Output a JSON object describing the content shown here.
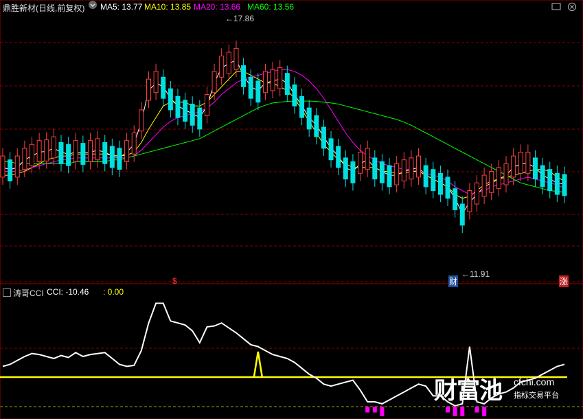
{
  "header": {
    "title": "鼎胜新材(日线,前复权)",
    "ma5_label": "MA5: 13.77",
    "ma10_label": "MA10: 13.85",
    "ma20_label": "MA20: 13.66",
    "ma60_label": "MA60: 13.56",
    "dropdown_icon": "chevron-down-icon",
    "window_buttons": [
      "restore-icon",
      "close-icon"
    ]
  },
  "colors": {
    "up": "#ff4040",
    "down": "#00e0e0",
    "ma5": "#ffffff",
    "ma10": "#ffff00",
    "ma20": "#ff00ff",
    "ma60": "#00ff00",
    "cci_line": "#ffffff",
    "baseline": "#ffff00",
    "grid": "#8a0000",
    "neg_fill": "#ff00ff"
  },
  "price_panel": {
    "high_label": "17.86",
    "low_label": "11.91",
    "markers": [
      "$",
      "财",
      "涨"
    ]
  },
  "indicator_panel": {
    "name": "涛哥CCI",
    "value_label": "CCI: -10.46",
    "zero_label": ": 0.00"
  },
  "watermark": {
    "logo_text": "财富池",
    "site": "cfchi.com",
    "slogan": "指标交易平台"
  },
  "chart_data": [
    {
      "type": "candlestick",
      "title": "鼎胜新材(日线,前复权)",
      "ylim": [
        11.5,
        18.2
      ],
      "annotations": [
        {
          "text": "17.86",
          "type": "high"
        },
        {
          "text": "11.91",
          "type": "low"
        }
      ],
      "series": [
        {
          "name": "MA5",
          "values": [
            14.2,
            14.15,
            14.2,
            14.4,
            14.5,
            14.6,
            14.62,
            14.7,
            14.6,
            14.55,
            14.6,
            14.58,
            14.6,
            14.65,
            14.6,
            14.5,
            14.45,
            14.6,
            14.8,
            15.4,
            16.2,
            16.4,
            16.3,
            16.0,
            15.8,
            15.7,
            15.6,
            15.5,
            15.8,
            16.4,
            16.8,
            16.9,
            17.0,
            16.6,
            16.3,
            16.2,
            16.4,
            16.45,
            16.5,
            16.4,
            16.1,
            15.8,
            15.5,
            15.3,
            15.0,
            14.7,
            14.5,
            14.2,
            14.1,
            14.3,
            14.4,
            14.2,
            14.1,
            14.0,
            14.0,
            14.1,
            14.15,
            14.2,
            14.0,
            13.9,
            13.8,
            13.7,
            13.4,
            13.0,
            13.3,
            13.5,
            13.7,
            13.8,
            13.9,
            14.0,
            14.2,
            14.3,
            14.3,
            14.2,
            14.0,
            13.9,
            13.8,
            13.77
          ]
        },
        {
          "name": "MA10",
          "values": [
            14.0,
            14.0,
            14.05,
            14.1,
            14.2,
            14.3,
            14.4,
            14.45,
            14.5,
            14.5,
            14.55,
            14.55,
            14.55,
            14.55,
            14.55,
            14.52,
            14.5,
            14.52,
            14.6,
            14.85,
            15.2,
            15.5,
            15.8,
            15.9,
            15.9,
            15.9,
            15.8,
            15.8,
            15.9,
            16.1,
            16.3,
            16.5,
            16.7,
            16.7,
            16.6,
            16.5,
            16.4,
            16.4,
            16.3,
            16.2,
            16.0,
            15.7,
            15.4,
            15.1,
            14.8,
            14.6,
            14.4,
            14.3,
            14.2,
            14.2,
            14.2,
            14.2,
            14.1,
            14.1,
            14.05,
            14.05,
            14.1,
            14.1,
            14.0,
            13.9,
            13.8,
            13.7,
            13.5,
            13.4,
            13.45,
            13.6,
            13.75,
            13.85,
            13.9,
            13.95,
            14.0,
            14.05,
            14.1,
            14.15,
            14.15,
            14.1,
            13.95,
            13.85
          ]
        },
        {
          "name": "MA20",
          "values": [
            14.1,
            14.1,
            14.1,
            14.15,
            14.2,
            14.25,
            14.3,
            14.35,
            14.4,
            14.42,
            14.45,
            14.45,
            14.45,
            14.45,
            14.45,
            14.45,
            14.45,
            14.45,
            14.5,
            14.65,
            14.85,
            15.05,
            15.25,
            15.4,
            15.5,
            15.55,
            15.6,
            15.65,
            15.75,
            15.9,
            16.1,
            16.25,
            16.4,
            16.5,
            16.55,
            16.6,
            16.65,
            16.7,
            16.75,
            16.75,
            16.7,
            16.6,
            16.45,
            16.25,
            16.0,
            15.7,
            15.4,
            15.1,
            14.85,
            14.65,
            14.5,
            14.4,
            14.3,
            14.25,
            14.2,
            14.15,
            14.15,
            14.1,
            14.05,
            14.0,
            13.95,
            13.85,
            13.7,
            13.6,
            13.5,
            13.55,
            13.6,
            13.7,
            13.75,
            13.8,
            13.85,
            13.9,
            13.95,
            13.9,
            13.85,
            13.8,
            13.75,
            13.66
          ]
        },
        {
          "name": "MA60",
          "values": [
            14.35,
            14.35,
            14.3,
            14.3,
            14.3,
            14.3,
            14.3,
            14.3,
            14.3,
            14.3,
            14.35,
            14.35,
            14.35,
            14.35,
            14.35,
            14.4,
            14.4,
            14.45,
            14.5,
            14.55,
            14.6,
            14.65,
            14.7,
            14.75,
            14.8,
            14.85,
            14.9,
            14.95,
            15.05,
            15.15,
            15.25,
            15.35,
            15.45,
            15.55,
            15.65,
            15.75,
            15.82,
            15.88,
            15.9,
            15.92,
            15.93,
            15.93,
            15.93,
            15.92,
            15.9,
            15.88,
            15.85,
            15.8,
            15.75,
            15.7,
            15.65,
            15.6,
            15.55,
            15.5,
            15.45,
            15.38,
            15.3,
            15.2,
            15.1,
            15.0,
            14.9,
            14.8,
            14.7,
            14.6,
            14.5,
            14.4,
            14.3,
            14.2,
            14.1,
            14.0,
            13.9,
            13.8,
            13.75,
            13.7,
            13.65,
            13.6,
            13.58,
            13.56
          ]
        }
      ]
    },
    {
      "type": "line",
      "title": "涛哥CCI",
      "ylim": [
        -280,
        340
      ],
      "series": [
        {
          "name": "CCI",
          "values": [
            -20,
            -10,
            10,
            30,
            45,
            40,
            30,
            20,
            35,
            25,
            50,
            30,
            40,
            45,
            50,
            20,
            -10,
            -20,
            -15,
            60,
            200,
            300,
            300,
            210,
            200,
            190,
            160,
            100,
            180,
            185,
            200,
            175,
            150,
            120,
            90,
            80,
            60,
            40,
            30,
            20,
            0,
            -30,
            -60,
            -80,
            -110,
            -120,
            -110,
            -100,
            -90,
            -140,
            -200,
            -200,
            -210,
            -190,
            -170,
            -150,
            -130,
            -110,
            -120,
            -170,
            -170,
            -200,
            -220,
            -210,
            80,
            -200,
            -210,
            -180,
            -160,
            -150,
            -130,
            -100,
            -90,
            -80,
            -60,
            -40,
            -20,
            -10
          ]
        },
        {
          "name": "0.00",
          "values": [
            0,
            0,
            0,
            0,
            0,
            0,
            0,
            0,
            0,
            0,
            0,
            0,
            0,
            0,
            0,
            0,
            0,
            0,
            0,
            0,
            0,
            0,
            0,
            0,
            0,
            0,
            0,
            0,
            0,
            0,
            0,
            0,
            0,
            0,
            0,
            0,
            0,
            0,
            0,
            0,
            0,
            0,
            0,
            0,
            0,
            0,
            0,
            0,
            0,
            0,
            0,
            0,
            0,
            0,
            0,
            0,
            0,
            0,
            0,
            0,
            0,
            0,
            0,
            0,
            0,
            0,
            0,
            0,
            0,
            0,
            0,
            0,
            0,
            0,
            0,
            0,
            0,
            0
          ]
        }
      ]
    }
  ]
}
